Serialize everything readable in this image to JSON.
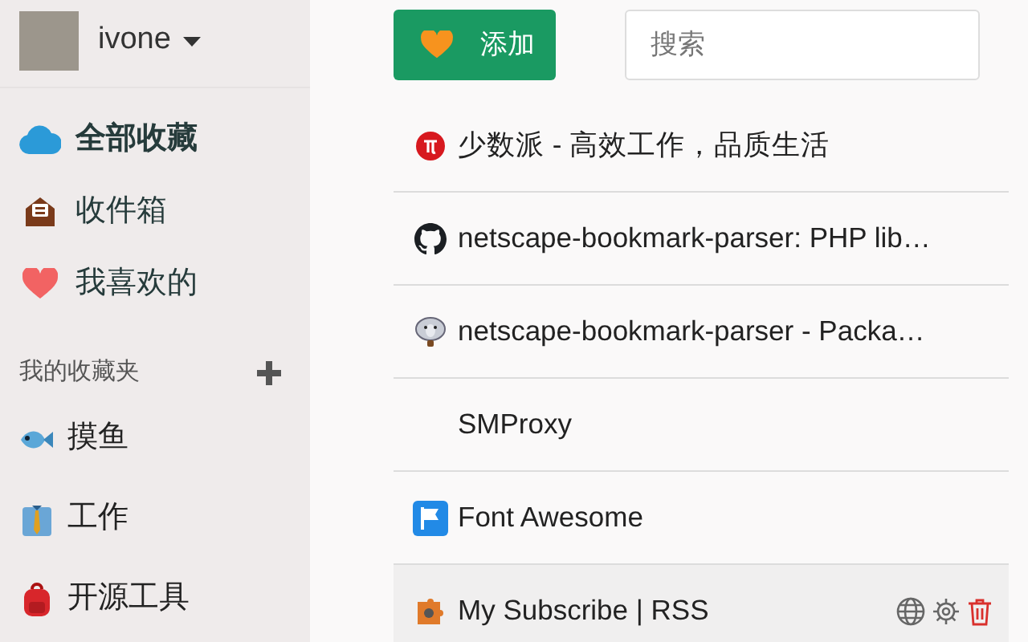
{
  "user": {
    "name": "ivone"
  },
  "nav": [
    {
      "label": "全部收藏",
      "kind": "cloud",
      "selected": true
    },
    {
      "label": "收件箱",
      "kind": "inbox",
      "selected": false
    },
    {
      "label": "我喜欢的",
      "kind": "heart",
      "selected": false
    }
  ],
  "folders_header": {
    "title": "我的收藏夹"
  },
  "folders": [
    {
      "label": "摸鱼",
      "kind": "fish"
    },
    {
      "label": "工作",
      "kind": "shirt"
    },
    {
      "label": "开源工具",
      "kind": "backpack"
    }
  ],
  "add_button": {
    "label": "添加"
  },
  "search": {
    "placeholder": "搜索"
  },
  "bookmarks": [
    {
      "title": "少数派 - 高效工作，品质生活",
      "kind": "pi",
      "hovered": false
    },
    {
      "title": "netscape-bookmark-parser: PHP lib…",
      "kind": "github",
      "hovered": false
    },
    {
      "title": "netscape-bookmark-parser - Packa…",
      "kind": "elephant",
      "hovered": false
    },
    {
      "title": "SMProxy",
      "kind": "blank",
      "hovered": false
    },
    {
      "title": "Font Awesome",
      "kind": "flag",
      "hovered": false
    },
    {
      "title": "My Subscribe | RSS",
      "kind": "puzzle",
      "hovered": true
    }
  ]
}
